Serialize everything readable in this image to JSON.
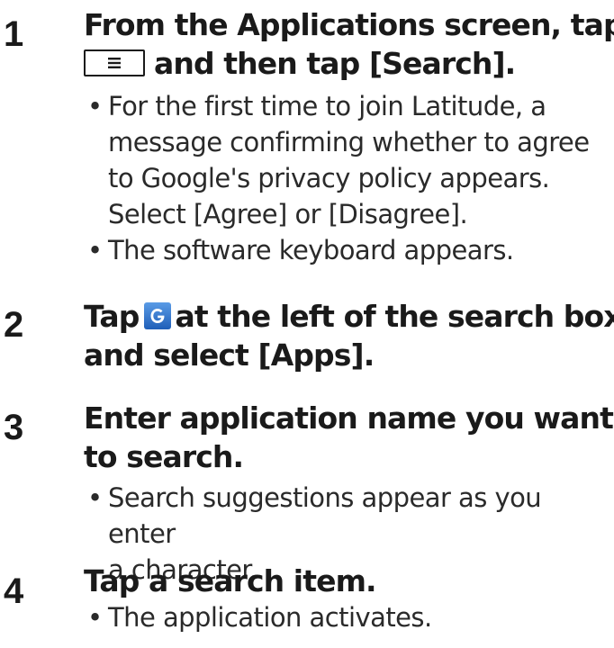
{
  "steps": [
    {
      "number": "1",
      "title_lines": [
        "From the Applications screen, tap",
        "and then tap [Search]."
      ],
      "title_icon": "menu-key-icon",
      "bullets": [
        "For the first time to join Latitude, a",
        "message confirming whether to agree",
        "to Google's privacy policy appears.",
        "Select [Agree] or [Disagree].",
        "The software keyboard appears."
      ]
    },
    {
      "number": "2",
      "title_lines": [
        "Tap",
        "at the left of the search box",
        "and select [Apps]."
      ],
      "title_icon": "google-search-icon",
      "bullets": []
    },
    {
      "number": "3",
      "title_lines": [
        "Enter application name you want",
        "to search."
      ],
      "bullets": [
        "Search suggestions appear as you enter",
        "a character."
      ]
    },
    {
      "number": "4",
      "title_lines": [
        "Tap a search item."
      ],
      "bullets": [
        "The application activates."
      ]
    }
  ],
  "colors": {
    "text": "#1a1a1a",
    "icon_blue": "#2f6fc4"
  }
}
